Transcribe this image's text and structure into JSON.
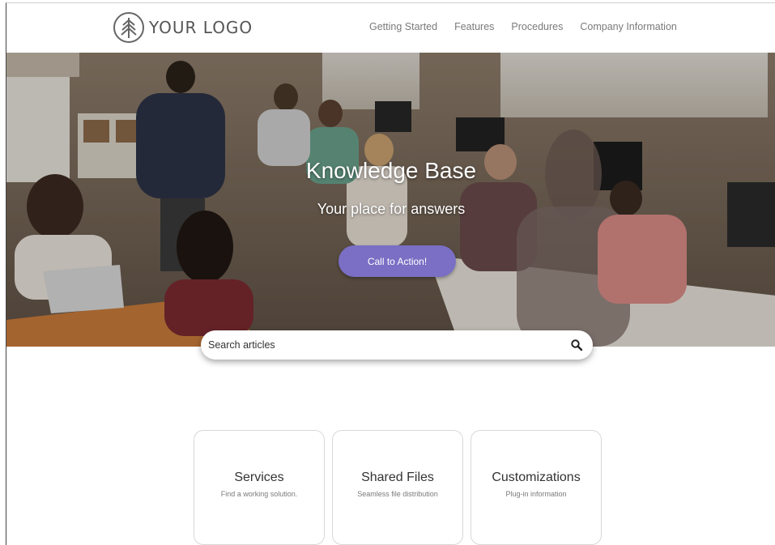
{
  "header": {
    "logo_text": "YOUR LOGO",
    "nav": [
      "Getting Started",
      "Features",
      "Procedures",
      "Company Information"
    ]
  },
  "hero": {
    "title": "Knowledge Base",
    "subtitle": "Your place for answers",
    "cta_label": "Call to Action!"
  },
  "search": {
    "placeholder": "Search articles",
    "icon": "search-icon"
  },
  "cards": [
    {
      "title": "Services",
      "description": "Find a working solution."
    },
    {
      "title": "Shared Files",
      "description": "Seamless file distribution"
    },
    {
      "title": "Customizations",
      "description": "Plug-in information"
    }
  ],
  "colors": {
    "accent": "#7a6fc4",
    "nav_text": "#7a7a7a",
    "card_border": "#d8d8d8"
  }
}
